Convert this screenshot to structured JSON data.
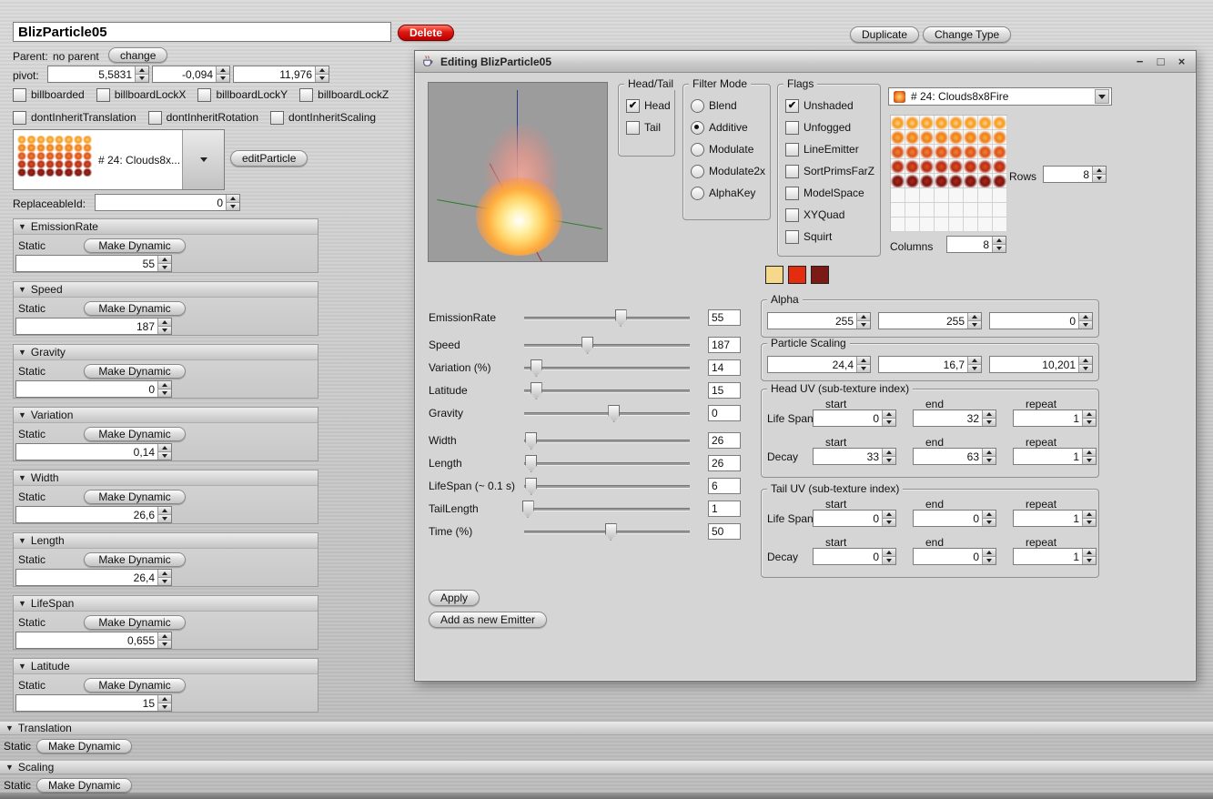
{
  "icons": {
    "collapse": "▼",
    "check": "✔",
    "minimize": "−",
    "maximize": "□",
    "close": "×"
  },
  "colors": {
    "accent_red": "#cf1c12",
    "swatches": [
      "#f6d88c",
      "#e42c0e",
      "#7c1a16"
    ]
  },
  "main": {
    "name_value": "BlizParticle05",
    "delete_label": "Delete",
    "duplicate_label": "Duplicate",
    "change_type_label": "Change Type",
    "parent_label": "Parent:",
    "parent_value": "no parent",
    "change_label": "change",
    "pivot_label": "pivot:",
    "pivot_values": [
      "5,5831",
      "-0,094",
      "11,976"
    ],
    "checkbox_rows": [
      [
        {
          "label": "billboarded",
          "checked": false
        },
        {
          "label": "billboardLockX",
          "checked": false
        },
        {
          "label": "billboardLockY",
          "checked": false
        },
        {
          "label": "billboardLockZ",
          "checked": false
        }
      ],
      [
        {
          "label": "dontInheritTranslation",
          "checked": false
        },
        {
          "label": "dontInheritRotation",
          "checked": false
        },
        {
          "label": "dontInheritScaling",
          "checked": false
        }
      ]
    ],
    "texture_combo_label": "# 24: Clouds8x...",
    "edit_particle_label": "editParticle",
    "replaceable_label": "ReplaceableId:",
    "replaceable_value": "0",
    "static_label": "Static",
    "make_dynamic_label": "Make Dynamic",
    "sections": [
      {
        "title": "EmissionRate",
        "value": "55"
      },
      {
        "title": "Speed",
        "value": "187"
      },
      {
        "title": "Gravity",
        "value": "0"
      },
      {
        "title": "Variation",
        "value": "0,14"
      },
      {
        "title": "Width",
        "value": "26,6"
      },
      {
        "title": "Length",
        "value": "26,4"
      },
      {
        "title": "LifeSpan",
        "value": "0,655"
      },
      {
        "title": "Latitude",
        "value": "15"
      }
    ],
    "bottom_sections": [
      "Translation",
      "Scaling"
    ]
  },
  "dialog": {
    "title": "Editing BlizParticle05",
    "head_tail_title": "Head/Tail",
    "head_tail": [
      {
        "label": "Head",
        "checked": true
      },
      {
        "label": "Tail",
        "checked": false
      }
    ],
    "filter_mode_title": "Filter Mode",
    "filter_modes": [
      {
        "label": "Blend",
        "selected": false
      },
      {
        "label": "Additive",
        "selected": true
      },
      {
        "label": "Modulate",
        "selected": false
      },
      {
        "label": "Modulate2x",
        "selected": false
      },
      {
        "label": "AlphaKey",
        "selected": false
      }
    ],
    "flags_title": "Flags",
    "flags": [
      {
        "label": "Unshaded",
        "checked": true
      },
      {
        "label": "Unfogged",
        "checked": false
      },
      {
        "label": "LineEmitter",
        "checked": false
      },
      {
        "label": "SortPrimsFarZ",
        "checked": false
      },
      {
        "label": "ModelSpace",
        "checked": false
      },
      {
        "label": "XYQuad",
        "checked": false
      },
      {
        "label": "Squirt",
        "checked": false
      }
    ],
    "texture_combo_label": "# 24: Clouds8x8Fire",
    "rows_label": "Rows",
    "rows_value": "8",
    "columns_label": "Columns",
    "columns_value": "8",
    "sliders": [
      {
        "label": "EmissionRate",
        "value": "55",
        "percent": 58
      },
      {
        "label": "Speed",
        "value": "187",
        "percent": 38
      },
      {
        "label": "Variation (%)",
        "value": "14",
        "percent": 7
      },
      {
        "label": "Latitude",
        "value": "15",
        "percent": 7
      },
      {
        "label": "Gravity",
        "value": "0",
        "percent": 54
      },
      {
        "label": "Width",
        "value": "26",
        "percent": 4
      },
      {
        "label": "Length",
        "value": "26",
        "percent": 4
      },
      {
        "label": "LifeSpan (~ 0.1 s)",
        "value": "6",
        "percent": 4
      },
      {
        "label": "TailLength",
        "value": "1",
        "percent": 2
      },
      {
        "label": "Time (%)",
        "value": "50",
        "percent": 52
      }
    ],
    "alpha_title": "Alpha",
    "alpha_values": [
      "255",
      "255",
      "0"
    ],
    "particle_scaling_title": "Particle Scaling",
    "particle_scaling_values": [
      "24,4",
      "16,7",
      "10,201"
    ],
    "uv_headers": [
      "start",
      "end",
      "repeat"
    ],
    "head_uv_title": "Head UV (sub-texture index)",
    "head_uv_rows": [
      {
        "label": "Life Span",
        "values": [
          "0",
          "32",
          "1"
        ]
      },
      {
        "label": "Decay",
        "values": [
          "33",
          "63",
          "1"
        ]
      }
    ],
    "tail_uv_title": "Tail UV (sub-texture index)",
    "tail_uv_rows": [
      {
        "label": "Life Span",
        "values": [
          "0",
          "0",
          "1"
        ]
      },
      {
        "label": "Decay",
        "values": [
          "0",
          "0",
          "1"
        ]
      }
    ],
    "apply_label": "Apply",
    "add_emitter_label": "Add as new Emitter",
    "texture_grid": {
      "rows": 8,
      "cols": 8,
      "row_colors": [
        "#ffd27a|#f6991f",
        "#f7b04a|#ef7d18",
        "#ef8136|#d9541a",
        "#d94f24|#b52f14",
        "#a8281c|#7c150f",
        "",
        "",
        ""
      ]
    }
  }
}
